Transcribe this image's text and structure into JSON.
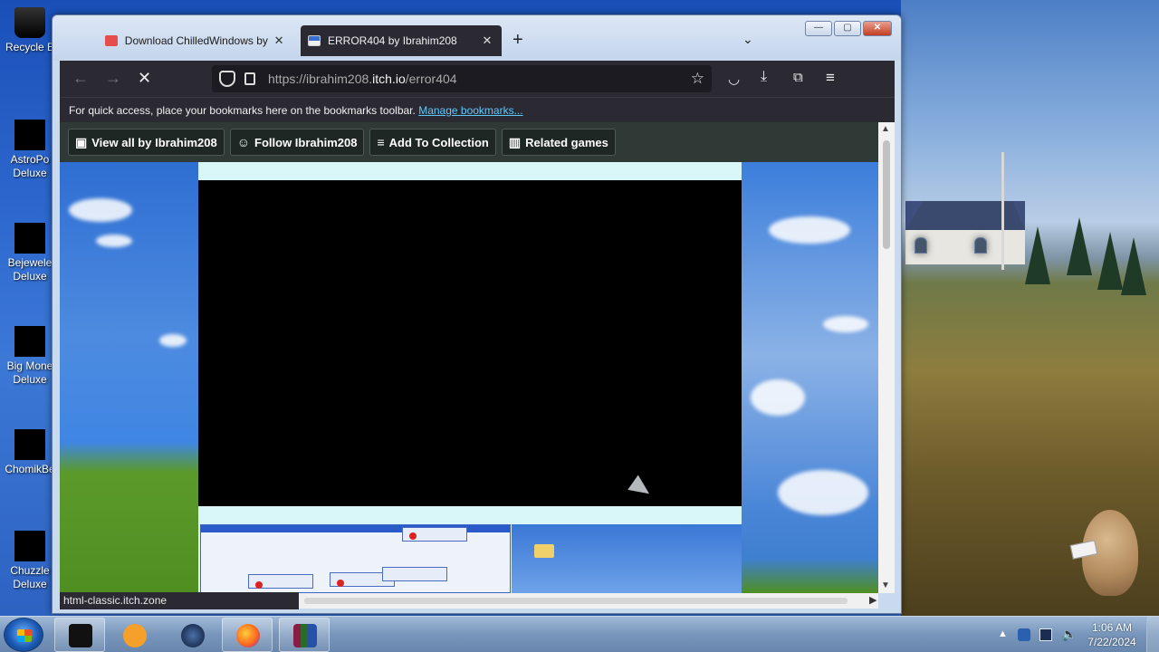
{
  "desktop": {
    "icons": [
      {
        "label_1": "Recycle B",
        "label_2": ""
      },
      {
        "label_1": "AstroPo",
        "label_2": "Deluxe"
      },
      {
        "label_1": "Bejewele",
        "label_2": "Deluxe"
      },
      {
        "label_1": "Big Mone",
        "label_2": "Deluxe"
      },
      {
        "label_1": "ChomikBe",
        "label_2": ""
      },
      {
        "label_1": "Chuzzle",
        "label_2": "Deluxe"
      }
    ]
  },
  "browser": {
    "tabs": [
      {
        "label": "Download ChilledWindows by I",
        "close": "✕"
      },
      {
        "label": "ERROR404 by Ibrahim208",
        "close": "✕"
      }
    ],
    "new_tab": "+",
    "tab_list": "⌄",
    "window_buttons": {
      "minimize": "—",
      "maximize": "▢",
      "close": "✕"
    },
    "url": {
      "prefix": "https://ibrahim208.",
      "host": "itch.io",
      "path": "/error404"
    },
    "bookmarks_bar": {
      "text": "For quick access, place your bookmarks here on the bookmarks toolbar.",
      "link": "Manage bookmarks..."
    },
    "status_url": "html-classic.itch.zone"
  },
  "itch_bar": {
    "buttons": [
      {
        "icon": "store-icon",
        "label": "View all by Ibrahim208"
      },
      {
        "icon": "user-plus-icon",
        "label": "Follow Ibrahim208"
      },
      {
        "icon": "add-list-icon",
        "label": "Add To Collection"
      },
      {
        "icon": "map-icon",
        "label": "Related games"
      }
    ]
  },
  "taskbar": {
    "clock_time": "1:06 AM",
    "clock_date": "7/22/2024"
  },
  "colors": {
    "browser_dark": "#2b2a33",
    "itch_bar": "#2f3a36",
    "link": "#5ec8ff",
    "page_bg": "#d9f6f9"
  }
}
